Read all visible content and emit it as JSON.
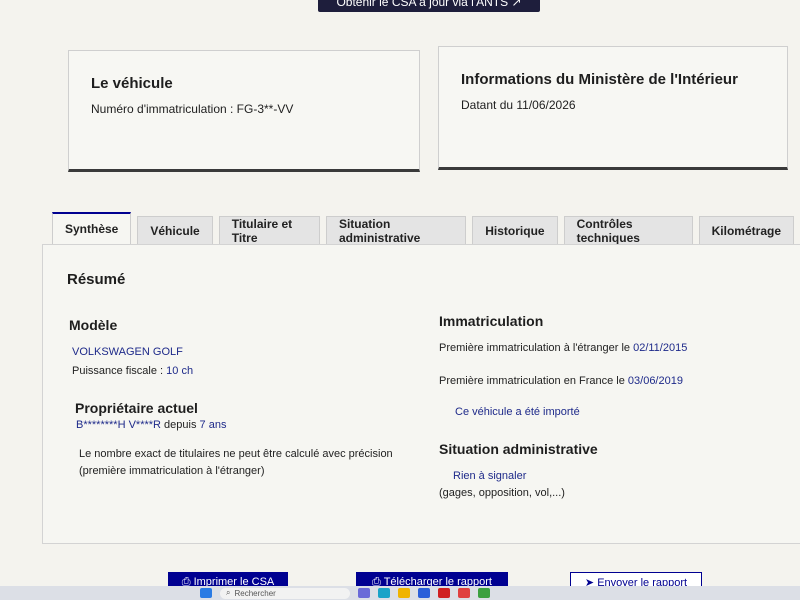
{
  "top_button": {
    "label": "Obtenir le CSA à jour via l'ANTS ↗"
  },
  "vehicle_card": {
    "title": "Le véhicule",
    "plate_text": "Numéro d'immatriculation : FG-3**-VV"
  },
  "ministry_card": {
    "title": "Informations du Ministère de l'Intérieur",
    "date_text": "Datant du 11/06/2026"
  },
  "tabs": [
    {
      "label": "Synthèse"
    },
    {
      "label": "Véhicule"
    },
    {
      "label": "Titulaire et Titre"
    },
    {
      "label": "Situation administrative"
    },
    {
      "label": "Historique"
    },
    {
      "label": "Contrôles techniques"
    },
    {
      "label": "Kilométrage"
    }
  ],
  "summary": {
    "title": "Résumé",
    "model": {
      "heading": "Modèle",
      "name": "VOLKSWAGEN GOLF",
      "power_label": "Puissance fiscale : ",
      "power_value": "10 ch"
    },
    "owner": {
      "heading": "Propriétaire actuel",
      "name": "B********H V****R",
      "since_label": " depuis ",
      "since_value": "7 ans",
      "note_line1": "Le nombre exact de titulaires ne peut être calculé avec précision",
      "note_line2": "(première immatriculation à l'étranger)"
    },
    "registration": {
      "heading": "Immatriculation",
      "abroad_label": "Première immatriculation à l'étranger le ",
      "abroad_date": "02/11/2015",
      "france_label": "Première immatriculation en France le ",
      "france_date": "03/06/2019",
      "imported_link": "Ce véhicule a été importé"
    },
    "admin": {
      "heading": "Situation administrative",
      "status_link": "Rien à signaler",
      "details": "(gages, opposition, vol,...)"
    }
  },
  "bottom_buttons": {
    "print": "⎙ Imprimer le CSA",
    "download": "⎙ Télécharger le rapport",
    "send": "➤ Envoyer le rapport"
  },
  "taskbar": {
    "search_placeholder": "Rechercher"
  }
}
